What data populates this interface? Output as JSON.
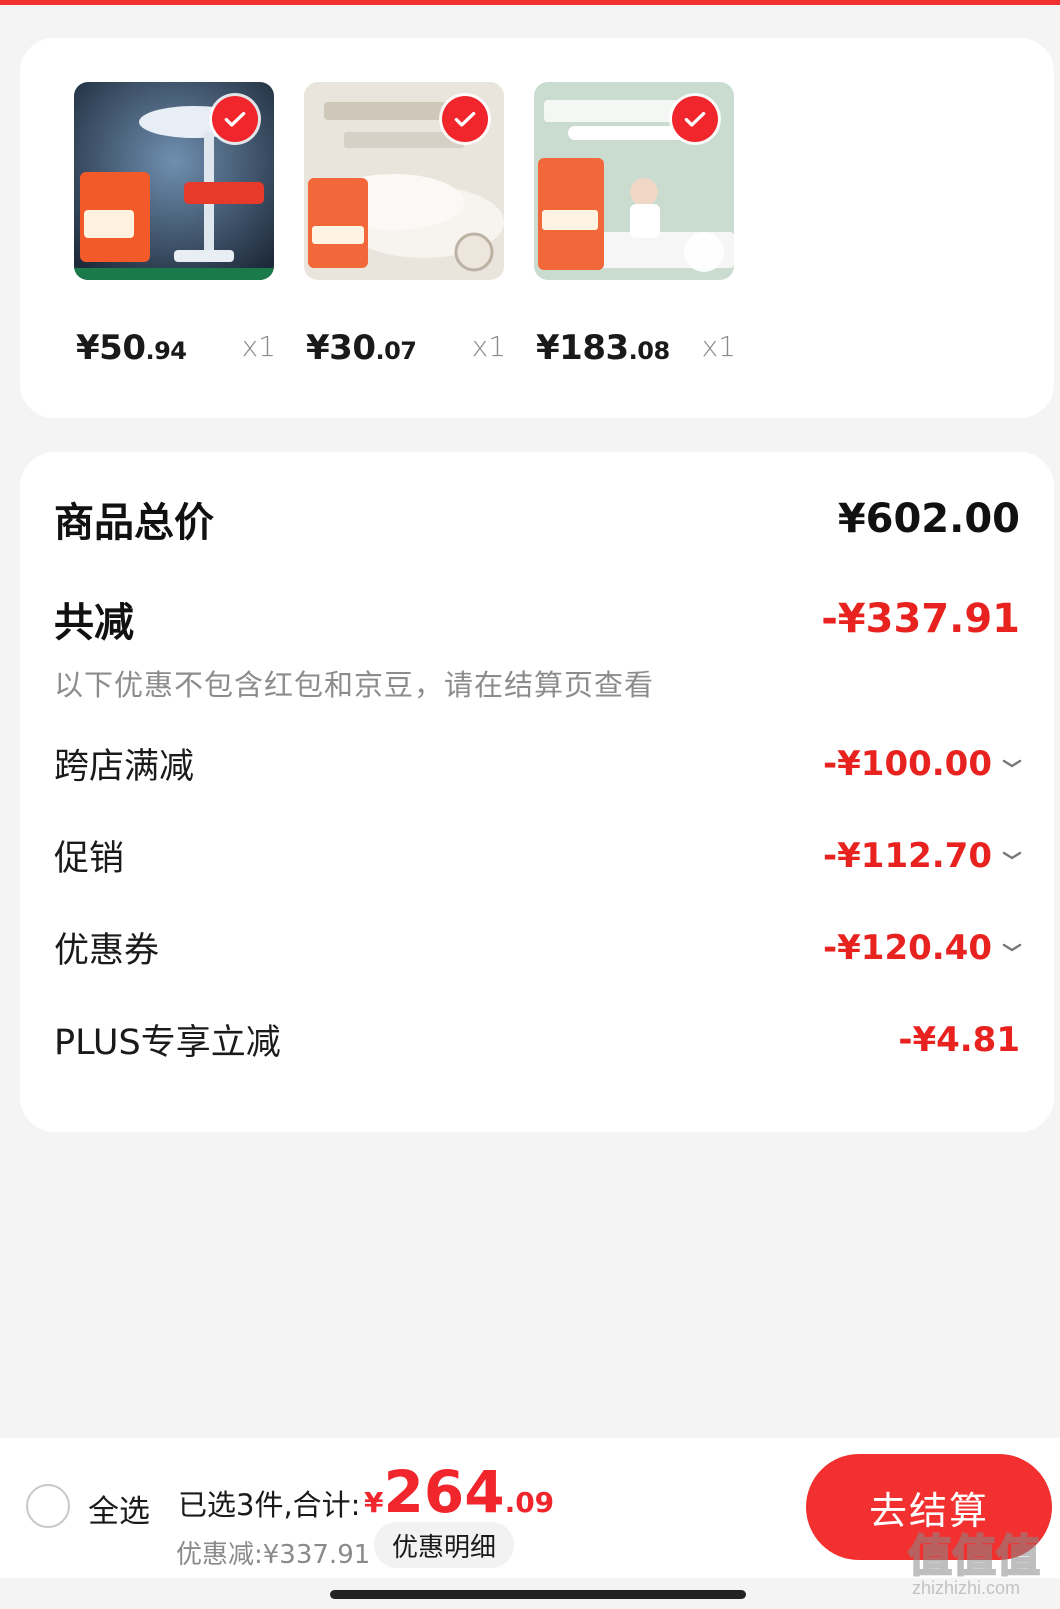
{
  "products": [
    {
      "price_int": "¥50",
      "price_dec": ".94",
      "qty": "x1"
    },
    {
      "price_int": "¥30",
      "price_dec": ".07",
      "qty": "x1"
    },
    {
      "price_int": "¥183",
      "price_dec": ".08",
      "qty": "x1"
    }
  ],
  "summary": {
    "total_label": "商品总价",
    "total_value": "¥602.00",
    "reduce_label": "共减",
    "reduce_value": "-¥337.91",
    "note": "以下优惠不包含红包和京豆，请在结算页查看",
    "items": [
      {
        "label": "跨店满减",
        "value": "-¥100.00",
        "expandable": true
      },
      {
        "label": "促销",
        "value": "-¥112.70",
        "expandable": true
      },
      {
        "label": "优惠券",
        "value": "-¥120.40",
        "expandable": true
      },
      {
        "label": "PLUS专享立减",
        "value": "-¥4.81",
        "expandable": false
      }
    ]
  },
  "bottom": {
    "select_all": "全选",
    "selected_text": "已选3件,合计:",
    "total_currency": "¥",
    "total_int": "264",
    "total_dec": ".09",
    "discount_text": "优惠减:¥337.91",
    "detail_button": "优惠明细",
    "checkout_button": "去结算"
  },
  "watermark": {
    "glyph": "值值值",
    "url": "zhizhizhi.com"
  },
  "colors": {
    "accent": "#f23030",
    "discount_red": "#e8231f"
  }
}
